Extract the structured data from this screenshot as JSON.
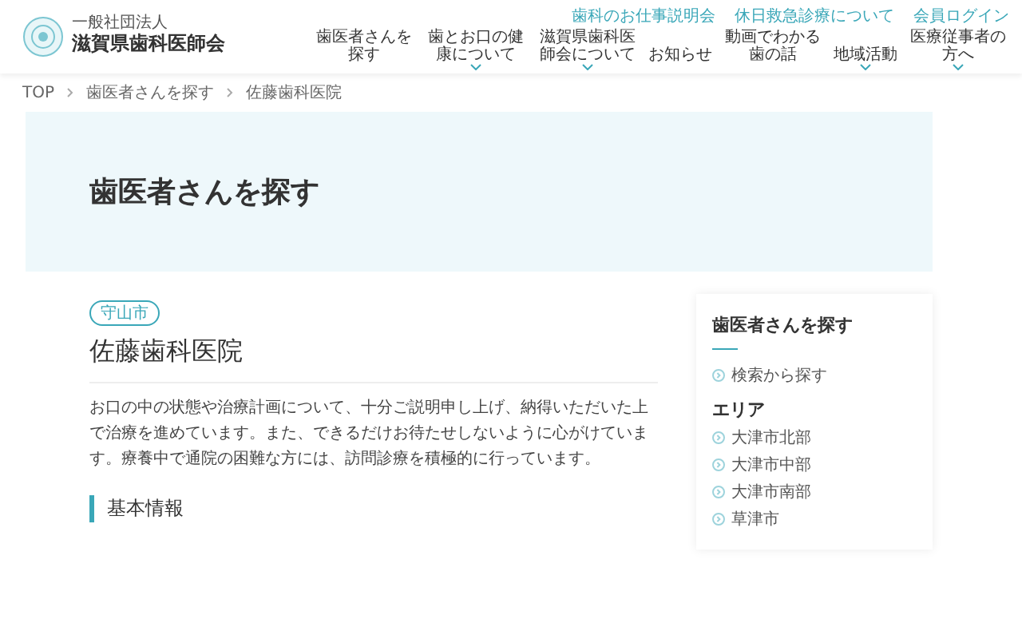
{
  "logo": {
    "subtitle": "一般社団法人",
    "name": "滋賀県歯科医師会"
  },
  "utility_links": [
    "歯科のお仕事説明会",
    "休日救急診療について",
    "会員ログイン"
  ],
  "nav": [
    {
      "label": "歯医者さんを探す",
      "has_submenu": false
    },
    {
      "label": "歯とお口の健康について",
      "has_submenu": true
    },
    {
      "label": "滋賀県歯科医師会について",
      "has_submenu": true
    },
    {
      "label": "お知らせ",
      "has_submenu": false
    },
    {
      "label": "動画でわかる歯の話",
      "has_submenu": false
    },
    {
      "label": "地域活動",
      "has_submenu": true
    },
    {
      "label": "医療従事者の方へ",
      "has_submenu": true
    }
  ],
  "breadcrumb": [
    "TOP",
    "歯医者さんを探す",
    "佐藤歯科医院"
  ],
  "hero": {
    "title": "歯医者さんを探す"
  },
  "clinic": {
    "area_tag": "守山市",
    "name": "佐藤歯科医院",
    "description": "お口の中の状態や治療計画について、十分ご説明申し上げ、納得いただいた上で治療を進めています。また、できるだけお待たせしないように心がけています。療養中で通院の困難な方には、訪問診療を積極的に行っています。",
    "section_heading": "基本情報"
  },
  "sidebar": {
    "title": "歯医者さんを探す",
    "links": [
      "検索から探す"
    ],
    "area_heading": "エリア",
    "areas": [
      "大津市北部",
      "大津市中部",
      "大津市南部",
      "草津市"
    ]
  }
}
